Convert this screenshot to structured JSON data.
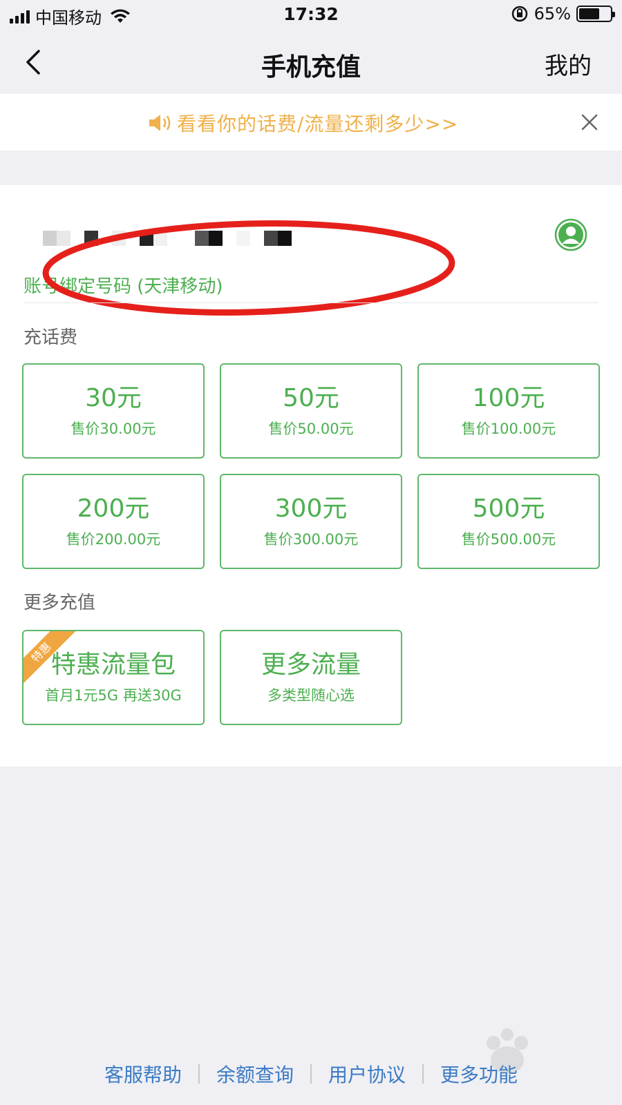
{
  "status_bar": {
    "carrier": "中国移动",
    "time": "17:32",
    "battery_percent": "65%",
    "battery_level": 0.65,
    "icons": [
      "signal-icon",
      "wifi-icon",
      "rotation-lock-icon",
      "battery-icon"
    ]
  },
  "nav": {
    "title": "手机充值",
    "right_label": "我的",
    "back_icon": "chevron-left-icon"
  },
  "notice": {
    "text": "看看你的话费/流量还剩多少>>",
    "icon": "speaker-icon",
    "close_icon": "close-icon",
    "color": "#f0b04a"
  },
  "account": {
    "bind_label": "账号绑定号码 (天津移动)",
    "avatar_icon": "user-avatar-icon"
  },
  "recharge": {
    "section_title": "充话费",
    "items": [
      {
        "amount": "30元",
        "price": "售价30.00元"
      },
      {
        "amount": "50元",
        "price": "售价50.00元"
      },
      {
        "amount": "100元",
        "price": "售价100.00元"
      },
      {
        "amount": "200元",
        "price": "售价200.00元"
      },
      {
        "amount": "300元",
        "price": "售价300.00元"
      },
      {
        "amount": "500元",
        "price": "售价500.00元"
      }
    ]
  },
  "more": {
    "section_title": "更多充值",
    "items": [
      {
        "title": "特惠流量包",
        "subtitle": "首月1元5G 再送30G",
        "badge": "特惠"
      },
      {
        "title": "更多流量",
        "subtitle": "多类型随心选"
      }
    ]
  },
  "footer": {
    "links": [
      "客服帮助",
      "余额查询",
      "用户协议",
      "更多功能"
    ]
  },
  "colors": {
    "accent_green": "#4caf50",
    "badge_orange": "#f0a640",
    "link_blue": "#3a7bc4",
    "highlight_red": "#e5201b"
  }
}
